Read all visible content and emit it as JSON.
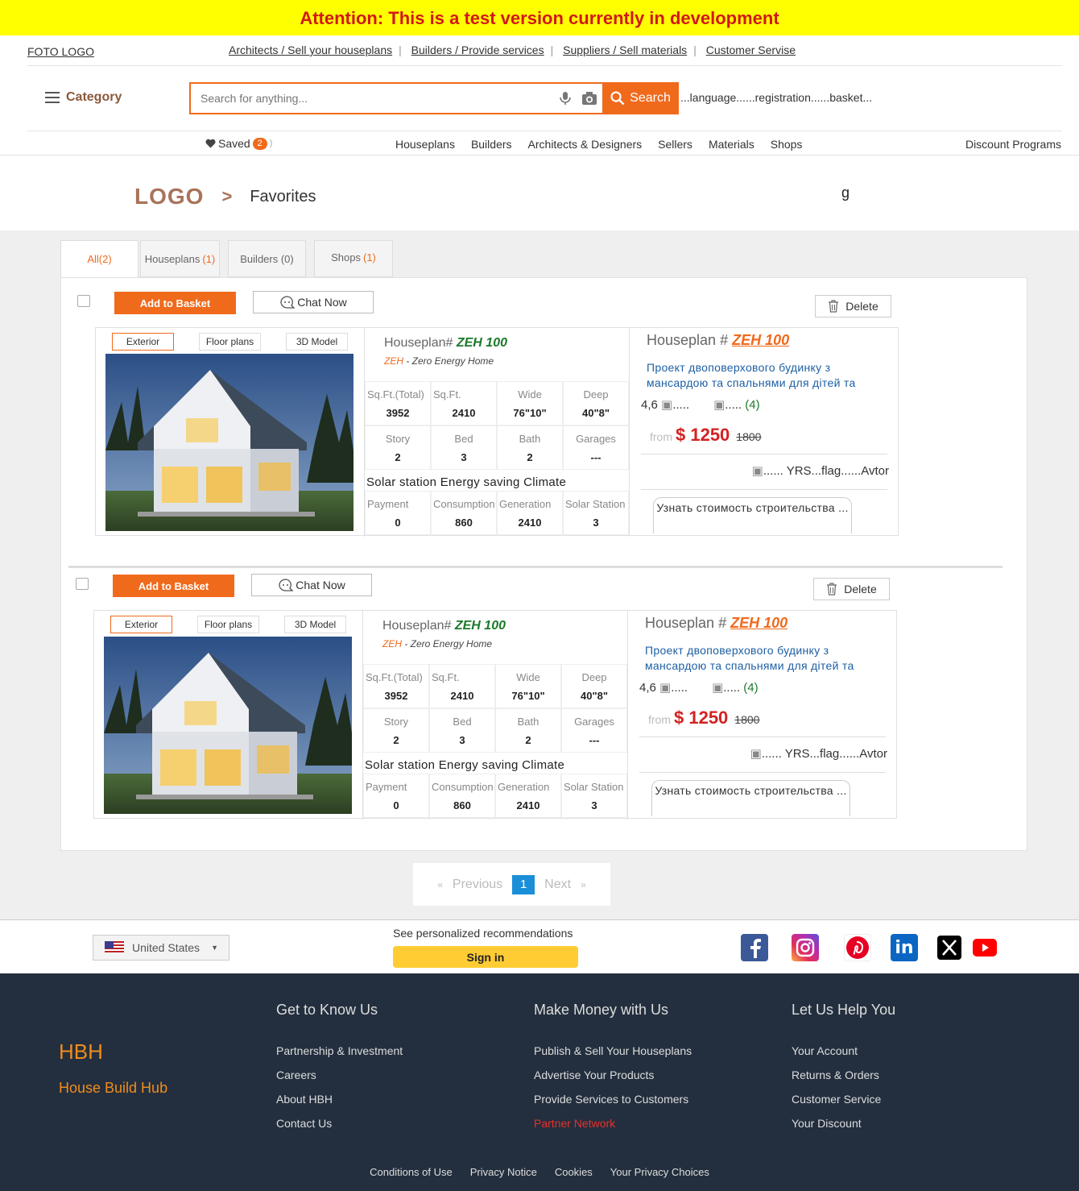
{
  "banner": "Attention: This is a test version currently in development",
  "header": {
    "foto_logo": "FOTO LOGO",
    "links": [
      "Architects / Sell your houseplans",
      "Builders / Provide services",
      "Suppliers / Sell materials",
      "Customer Servise"
    ],
    "category": "Category",
    "search_placeholder": "Search for anything...",
    "search_button": "Search",
    "language_registration": "...language......registration......basket...",
    "saved_label": "Saved",
    "saved_count": "2",
    "nav": [
      "Houseplans",
      "Builders",
      "Architects & Designers",
      "Sellers",
      "Materials",
      "Shops"
    ],
    "discount": "Discount Programs"
  },
  "breadcrumb": {
    "logo": "LOGO",
    "separator": ">",
    "page": "Favorites",
    "stray": "g"
  },
  "tabs": [
    {
      "label": "All(2)",
      "count": ""
    },
    {
      "label": "Houseplans",
      "count": "(1)"
    },
    {
      "label": "Builders (0)",
      "count": ""
    },
    {
      "label": "Shops",
      "count": "(1)"
    }
  ],
  "items": [
    {
      "add_to_basket": "Add to Basket",
      "chat": "Chat Now",
      "delete": "Delete",
      "image_tabs": [
        "Exterior",
        "Floor plans",
        "3D Model"
      ],
      "houseplan_prefix": "Houseplan#",
      "code": "ZEH 100",
      "zeh_abbr": "ZEH",
      "zeh_text": " - Zero Energy Home",
      "specs1": [
        {
          "l": "Sq.Ft.(Total)",
          "v": "3952"
        },
        {
          "l": "Sq.Ft.",
          "v": "2410"
        },
        {
          "l": "Wide",
          "v": "76\"10\""
        },
        {
          "l": "Deep",
          "v": "40\"8\""
        }
      ],
      "specs2": [
        {
          "l": "Story",
          "v": "2"
        },
        {
          "l": "Bed",
          "v": "3"
        },
        {
          "l": "Bath",
          "v": "2"
        },
        {
          "l": "Garages",
          "v": "---"
        }
      ],
      "solar_title": "Solar station Energy saving Climate",
      "specs3": [
        {
          "l": "Payment",
          "v": "0"
        },
        {
          "l": "Consumption",
          "v": "860"
        },
        {
          "l": "Generation",
          "v": "2410"
        },
        {
          "l": "Solar Station",
          "v": "3"
        }
      ],
      "right_prefix": "Houseplan #",
      "description": "Проект двоповерхового будинку з мансардою та спальнями для дітей та",
      "rating": "4,6",
      "img_alt1": ".....",
      "img_alt2": ".....",
      "reviews": "(4)",
      "from": "from",
      "price": "$ 1250",
      "old_price": "1800",
      "yrs": "...... YRS...flag......Avtor",
      "estimate": "Узнать стоимость строительства ..."
    },
    {
      "add_to_basket": "Add to Basket",
      "chat": "Chat Now",
      "delete": "Delete",
      "image_tabs": [
        "Exterior",
        "Floor plans",
        "3D Model"
      ],
      "houseplan_prefix": "Houseplan#",
      "code": "ZEH 100",
      "zeh_abbr": "ZEH",
      "zeh_text": " - Zero Energy Home",
      "specs1": [
        {
          "l": "Sq.Ft.(Total)",
          "v": "3952"
        },
        {
          "l": "Sq.Ft.",
          "v": "2410"
        },
        {
          "l": "Wide",
          "v": "76\"10\""
        },
        {
          "l": "Deep",
          "v": "40\"8\""
        }
      ],
      "specs2": [
        {
          "l": "Story",
          "v": "2"
        },
        {
          "l": "Bed",
          "v": "3"
        },
        {
          "l": "Bath",
          "v": "2"
        },
        {
          "l": "Garages",
          "v": "---"
        }
      ],
      "solar_title": "Solar station Energy saving Climate",
      "specs3": [
        {
          "l": "Payment",
          "v": "0"
        },
        {
          "l": "Consumption",
          "v": "860"
        },
        {
          "l": "Generation",
          "v": "2410"
        },
        {
          "l": "Solar Station",
          "v": "3"
        }
      ],
      "right_prefix": "Houseplan #",
      "description": "Проект двоповерхового будинку з мансардою та спальнями для дітей та",
      "rating": "4,6",
      "img_alt1": ".....",
      "img_alt2": ".....",
      "reviews": "(4)",
      "from": "from",
      "price": "$ 1250",
      "old_price": "1800",
      "yrs": "...... YRS...flag......Avtor",
      "estimate": "Узнать стоимость строительства ..."
    }
  ],
  "pagination": {
    "prev_arrow": "«",
    "previous": "Previous",
    "current": "1",
    "next": "Next",
    "next_arrow": "»"
  },
  "footer": {
    "country": "United States",
    "recommendations": "See personalized recommendations",
    "sign_in": "Sign in",
    "brand": "HBH",
    "brand_full": "House Build Hub",
    "col1": {
      "title": "Get to Know Us",
      "items": [
        "Partnership & Investment",
        "Careers",
        "About HBH",
        "Contact Us"
      ]
    },
    "col2": {
      "title": "Make Money with Us",
      "items": [
        "Publish & Sell Your Houseplans",
        "Advertise Your Products",
        "Provide Services to Customers",
        "Partner Network"
      ]
    },
    "col3": {
      "title": "Let Us Help You",
      "items": [
        "Your Account",
        "Returns & Orders",
        "Customer Service",
        "Your Discount"
      ]
    },
    "legal": [
      "Conditions of Use",
      "Privacy Notice",
      "Cookies",
      "Your Privacy Choices"
    ],
    "accent": "#f06a1c"
  }
}
